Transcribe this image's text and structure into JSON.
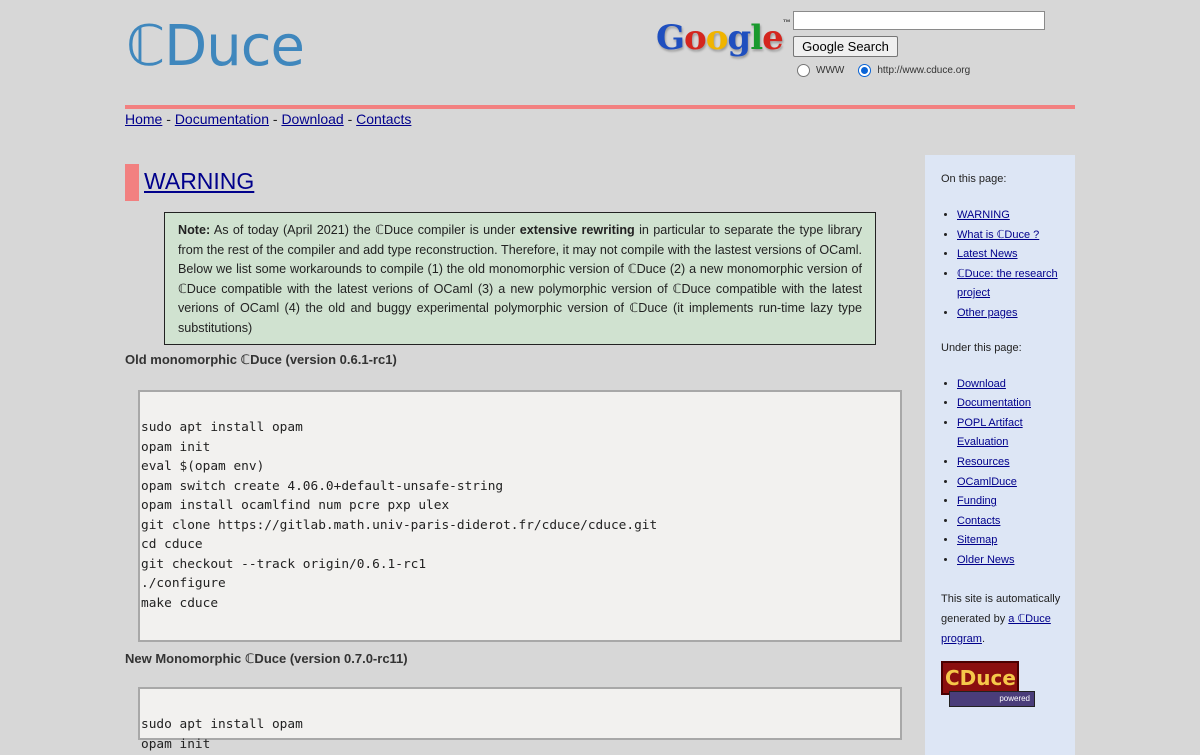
{
  "header": {
    "logo_text": "ℂDuce",
    "google_logo": "Google",
    "google_tm": "™",
    "search_value": "",
    "search_button": "Google Search",
    "radio_www": "WWW",
    "radio_site": "http://www.cduce.org",
    "selected_radio": "site"
  },
  "nav": {
    "items": [
      "Home",
      "Documentation",
      "Download",
      "Contacts"
    ],
    "separator": " - "
  },
  "main": {
    "warning_title": "WARNING",
    "note_label": "Note:",
    "note_text_1": " As of today (April 2021) the ℂDuce compiler is under ",
    "note_bold": "extensive rewriting",
    "note_text_2": " in particular to separate the type library from the rest of the compiler and add type reconstruction. Therefore, it may not compile with the lastest versions of OCaml. Below we list some workarounds to compile (1) the old monomorphic version of ℂDuce (2) a new monomorphic version of ℂDuce compatible with the latest verions of OCaml (3) a new polymorphic version of ℂDuce compatible with the latest verions of OCaml (4) the old and buggy experimental polymorphic version of ℂDuce (it implements run-time lazy type substitutions)",
    "section1_title": "Old monomorphic ℂDuce (version 0.6.1-rc1)",
    "section1_code": [
      "sudo apt install opam",
      "opam init",
      "eval $(opam env)",
      "opam switch create 4.06.0+default-unsafe-string",
      "opam install ocamlfind num pcre pxp ulex",
      "git clone https://gitlab.math.univ-paris-diderot.fr/cduce/cduce.git",
      "cd cduce",
      "git checkout --track origin/0.6.1-rc1",
      "./configure",
      "make cduce"
    ],
    "section2_title": "New Monomorphic ℂDuce (version 0.7.0-rc11)",
    "section2_code": [
      "sudo apt install opam",
      "opam init"
    ]
  },
  "sidebar": {
    "on_this_page": "On this page:",
    "page_links": [
      "WARNING",
      "What is ℂDuce ?",
      "Latest News",
      "ℂDuce: the research project",
      "Other pages"
    ],
    "under_this_page": "Under this page:",
    "sub_links": [
      "Download",
      "Documentation",
      "POPL Artifact Evaluation",
      "Resources",
      "OCamlDuce",
      "Funding",
      "Contacts",
      "Sitemap",
      "Older News"
    ],
    "generated_prefix": "This site is automatically generated by ",
    "generated_link": "a ℂDuce program",
    "generated_suffix": ".",
    "badge_main": "CDuce",
    "badge_sub": "powered"
  }
}
